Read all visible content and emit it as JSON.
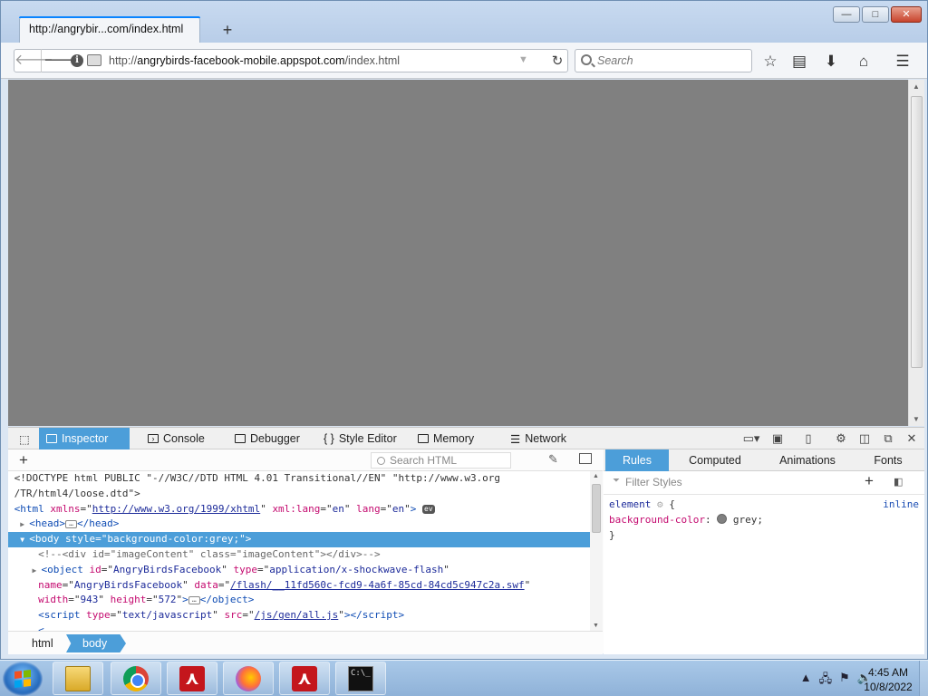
{
  "browser": {
    "tab_title": "http://angrybir...com/index.html",
    "new_tab": "+",
    "window_buttons": {
      "minimize": "—",
      "maximize": "□",
      "close": "✕"
    },
    "url_prefix": "http://",
    "url_host": "angrybirds-facebook-mobile.appspot.com",
    "url_path": "/index.html",
    "search_placeholder": "Search"
  },
  "devtools": {
    "tabs": [
      {
        "label": "Inspector"
      },
      {
        "label": "Console"
      },
      {
        "label": "Debugger"
      },
      {
        "label": "Style Editor"
      },
      {
        "label": "Memory"
      },
      {
        "label": "Network"
      }
    ],
    "search_html_placeholder": "Search HTML",
    "markup": {
      "doctype_1": "<!DOCTYPE html PUBLIC \"-//W3C//DTD HTML 4.01 Transitional//EN\" \"http://www.w3.org",
      "doctype_2": "/TR/html4/loose.dtd\">",
      "html_xmlns": "http://www.w3.org/1999/xhtml",
      "html_lang": "en",
      "body_style": "background-color:grey;",
      "comment": "<!--<div id=\"imageContent\" class=\"imageContent\"></div>-->",
      "object_id": "AngryBirdsFacebook",
      "object_type": "application/x-shockwave-flash",
      "object_name": "AngryBirdsFacebook",
      "object_data": "/flash/__11fd560c-fcd9-4a6f-85cd-84cd5c947c2a.swf",
      "object_width": "943",
      "object_height": "572",
      "script_type": "text/javascript",
      "script_src": "/js/gen/all.js",
      "event_badge": "ev"
    },
    "breadcrumbs": [
      "html",
      "body"
    ],
    "sidebar_tabs": [
      "Rules",
      "Computed",
      "Animations",
      "Fonts"
    ],
    "filter_placeholder": "Filter Styles",
    "rule": {
      "selector": "element",
      "source": "inline",
      "property": "background-color",
      "value": "grey",
      "swatch_color": "#808080"
    }
  },
  "taskbar": {
    "time": "4:45 AM",
    "date": "10/8/2022"
  },
  "colors": {
    "accent": "#4c9ed9",
    "page_background": "#808080"
  }
}
